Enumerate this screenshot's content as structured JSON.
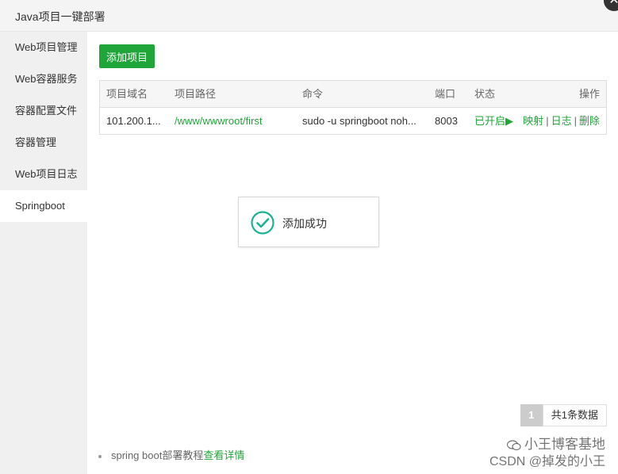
{
  "window": {
    "title": "Java项目一键部署",
    "close_symbol": "✕"
  },
  "sidebar": {
    "items": [
      {
        "label": "Web项目管理"
      },
      {
        "label": "Web容器服务"
      },
      {
        "label": "容器配置文件"
      },
      {
        "label": "容器管理"
      },
      {
        "label": "Web项目日志"
      },
      {
        "label": "Springboot",
        "active": true
      }
    ]
  },
  "toolbar": {
    "add_label": "添加项目"
  },
  "table": {
    "headers": {
      "domain": "项目域名",
      "path": "项目路径",
      "command": "命令",
      "port": "端口",
      "status": "状态",
      "actions": "操作"
    },
    "rows": [
      {
        "domain": "101.200.1...",
        "path": "/www/wwwroot/first",
        "command": "sudo -u springboot noh...",
        "port": "8003",
        "status": "已开启▶",
        "action_map": "映射",
        "action_log": "日志",
        "action_delete": "删除",
        "sep": "|"
      }
    ]
  },
  "toast": {
    "message": "添加成功",
    "icon": "check-circle-icon"
  },
  "pagination": {
    "current": "1",
    "total_text": "共1条数据"
  },
  "tip": {
    "text": "spring boot部署教程",
    "link": "查看详情"
  },
  "watermark": {
    "line1": "小王博客基地",
    "line2": "CSDN @掉发的小王"
  },
  "colors": {
    "accent": "#20a53a",
    "sidebar_bg": "#f0f0f0",
    "title_bg": "#f4f4f4"
  }
}
